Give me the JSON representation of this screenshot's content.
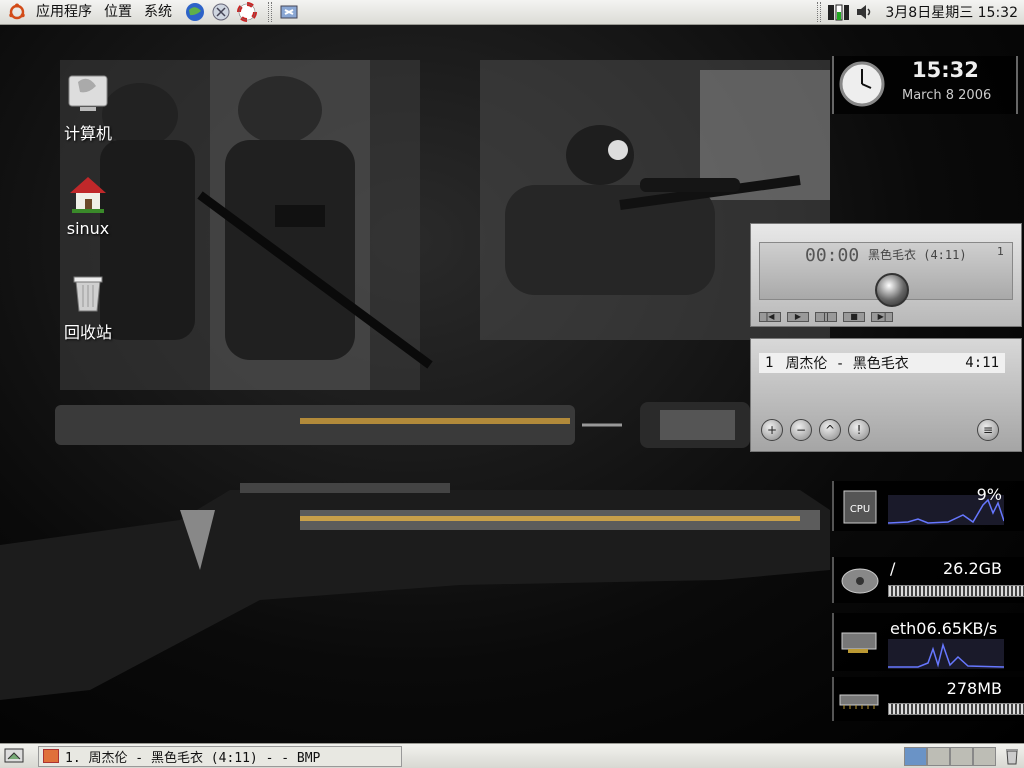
{
  "top_panel": {
    "menus": [
      "应用程序",
      "位置",
      "系统"
    ],
    "clock": "3月8日星期三 15:32"
  },
  "desktop": {
    "icons": [
      {
        "label": "计算机"
      },
      {
        "label": "sinux"
      },
      {
        "label": "回收站"
      }
    ]
  },
  "clock_widget": {
    "time": "15:32",
    "date": "March 8 2006"
  },
  "player": {
    "time": "00:00",
    "title": "黑色毛衣 (4:11)",
    "track_num": "1"
  },
  "playlist": {
    "index": "1",
    "song": "周杰伦 - 黑色毛衣",
    "duration": "4:11",
    "buttons": [
      "+",
      "−",
      "^",
      "!",
      "≡"
    ]
  },
  "monitor": {
    "cpu": "9%",
    "disk_mount": "/",
    "disk_size": "26.2GB",
    "net": "eth06.65KB/s",
    "memory": "278MB"
  },
  "taskbar": {
    "task": "1. 周杰伦 - 黑色毛衣 (4:11) - - BMP"
  },
  "colors": {
    "panel_bg": "#e6e6e0",
    "workspace_active": "#6a93c6"
  }
}
